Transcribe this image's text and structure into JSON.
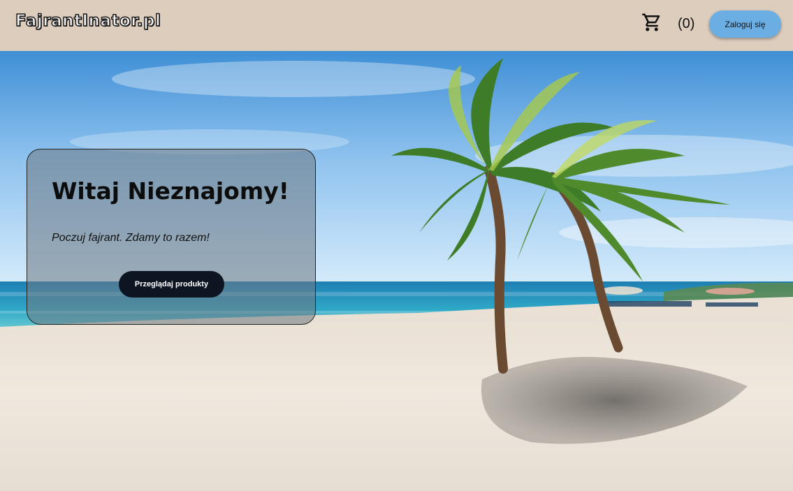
{
  "header": {
    "logo_text": "FajrantInator.pl",
    "cart_icon": "shopping-cart-icon",
    "cart_count": "(0)",
    "login_label": "Zaloguj się"
  },
  "hero": {
    "background": "beach-with-palm-trees-photo",
    "title": "Witaj Nieznajomy!",
    "subtitle": "Poczuj fajrant. Zdamy to razem!",
    "cta_label": "Przeglądaj produkty"
  },
  "colors": {
    "header_bg": "#dccdbd",
    "login_button_bg": "#6aaee3",
    "cta_button_bg": "#0d1522"
  }
}
